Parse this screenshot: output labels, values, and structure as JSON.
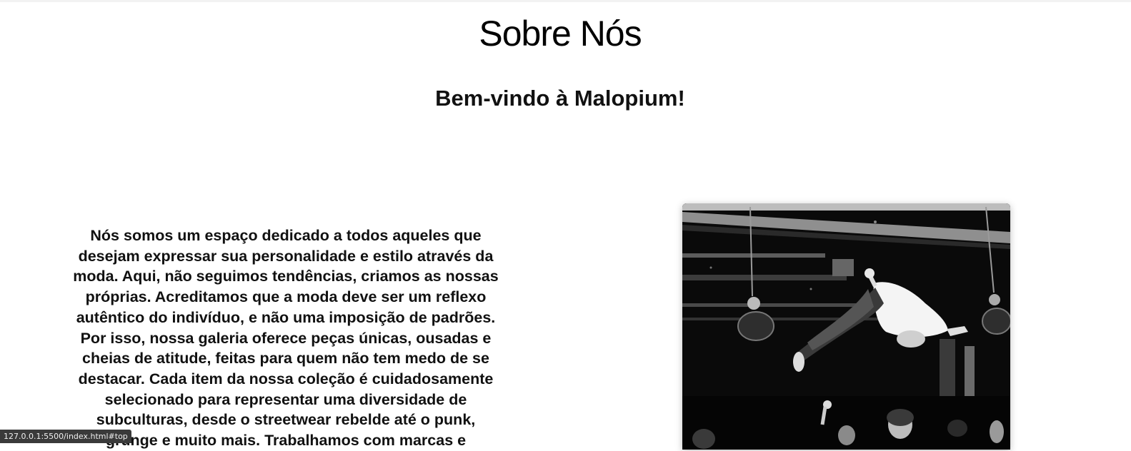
{
  "header": {
    "title": "Sobre Nós",
    "subtitle": "Bem-vindo à Malopium!"
  },
  "about": {
    "paragraph": "Nós somos um espaço dedicado a todos aqueles que desejam expressar sua personalidade e estilo através da moda. Aqui, não seguimos tendências, criamos as nossas próprias. Acreditamos que a moda deve ser um reflexo autêntico do indivíduo, e não uma imposição de padrões. Por isso, nossa galeria oferece peças únicas, ousadas e cheias de atitude, feitas para quem não tem medo de se destacar. Cada item da nossa coleção é cuidadosamente selecionado para representar uma diversidade de subculturas, desde o streetwear rebelde até o punk, grunge e muito mais. Trabalhamos com marcas e"
  },
  "image": {
    "icon": "crowd-surfing-photo",
    "tone": "black-and-white"
  },
  "status_bar": {
    "url": "127.0.0.1:5500/index.html#top"
  }
}
